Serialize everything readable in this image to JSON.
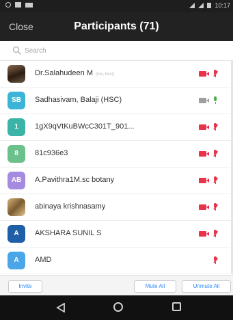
{
  "status_bar": {
    "time": "10:17"
  },
  "header": {
    "close_label": "Close",
    "title": "Participants (71)"
  },
  "search": {
    "placeholder": "Search"
  },
  "participants": [
    {
      "name": "Dr.Salahudeen M",
      "tag": "(me, host)",
      "avatar_type": "photo",
      "avatar_text": "",
      "avatar_color": "#5a3f2a",
      "video": "off",
      "audio": "muted"
    },
    {
      "name": "Sadhasivam, Balaji  (HSC)",
      "tag": "",
      "avatar_type": "initials",
      "avatar_text": "SB",
      "avatar_color": "#3cb4d8",
      "video": "on",
      "audio": "active"
    },
    {
      "name": "1gX9qVtKuBWcC301T_901...",
      "tag": "",
      "avatar_type": "initials",
      "avatar_text": "1",
      "avatar_color": "#3bb3a6",
      "video": "off",
      "audio": "muted"
    },
    {
      "name": "81c936e3",
      "tag": "",
      "avatar_type": "initials",
      "avatar_text": "8",
      "avatar_color": "#6cc08b",
      "video": "off",
      "audio": "muted"
    },
    {
      "name": "A.Pavithra1M.sc botany",
      "tag": "",
      "avatar_type": "initials",
      "avatar_text": "AB",
      "avatar_color": "#a58be0",
      "video": "off",
      "audio": "muted"
    },
    {
      "name": "abinaya krishnasamy",
      "tag": "",
      "avatar_type": "photo",
      "avatar_text": "",
      "avatar_color": "#c9a066",
      "video": "off",
      "audio": "muted"
    },
    {
      "name": "AKSHARA SUNIL S",
      "tag": "",
      "avatar_type": "initials",
      "avatar_text": "A",
      "avatar_color": "#1f5fa8",
      "video": "off",
      "audio": "muted"
    },
    {
      "name": "AMD",
      "tag": "",
      "avatar_type": "initials",
      "avatar_text": "A",
      "avatar_color": "#4aa6e8",
      "video": "none",
      "audio": "muted"
    }
  ],
  "footer": {
    "invite_label": "Invite",
    "mute_all_label": "Mute All",
    "unmute_all_label": "Unmute All"
  },
  "colors": {
    "accent": "#2d8cff",
    "muted_red": "#e8334a",
    "active_green": "#4caf50",
    "video_on_gray": "#9e9e9e",
    "header_bg": "#222222"
  },
  "icons": {
    "search": "search-icon",
    "video_off": "video-off-icon",
    "video_on": "video-on-icon",
    "mic_muted": "mic-muted-icon",
    "mic_active": "mic-active-icon",
    "nav_back": "back-icon",
    "nav_home": "home-icon",
    "nav_recent": "recent-apps-icon"
  }
}
